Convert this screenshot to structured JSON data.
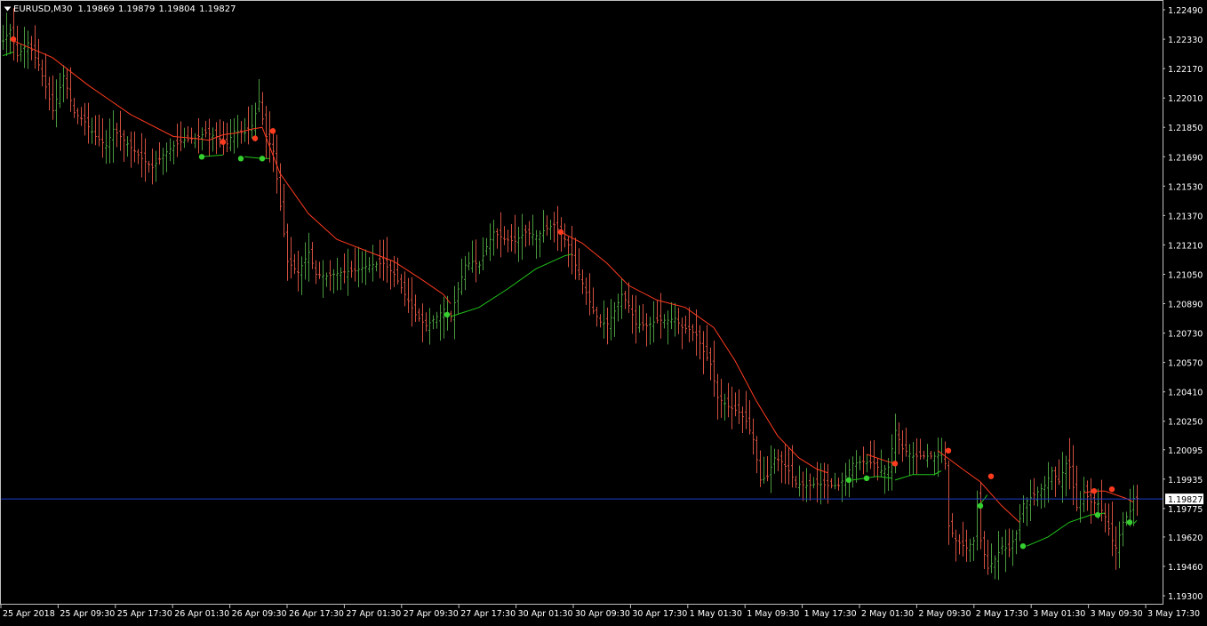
{
  "header": {
    "symbol_timeframe": "EURUSD,M30",
    "ohlc": "1.19869 1.19879 1.19804 1.19827"
  },
  "colors": {
    "background": "#000000",
    "frame": "#c0c0c0",
    "text": "#ffffff",
    "bull_bar": "#4a9a3e",
    "bear_bar": "#d2503f",
    "line_down": "#ff3b1f",
    "line_up": "#21c41a",
    "dot_down": "#ff3b1f",
    "dot_up": "#35d02f",
    "price_line": "#1e3cc8",
    "price_label_bg": "#ffffff",
    "price_label_text": "#000000"
  },
  "chart_data": {
    "type": "ohlc",
    "symbol": "EURUSD",
    "timeframe": "M30",
    "current_price": 1.19827,
    "current_price_label": "1.19827",
    "ylim": [
      1.193,
      1.2249
    ],
    "y_ticks": [
      "1.22490",
      "1.22330",
      "1.22170",
      "1.22010",
      "1.21850",
      "1.21690",
      "1.21530",
      "1.21370",
      "1.21210",
      "1.21050",
      "1.20890",
      "1.20730",
      "1.20570",
      "1.20410",
      "1.20250",
      "1.20095",
      "1.19935",
      "1.19775",
      "1.19620",
      "1.19460",
      "1.19300"
    ],
    "x_ticks": [
      "25 Apr 2018",
      "25 Apr 09:30",
      "25 Apr 17:30",
      "26 Apr 01:30",
      "26 Apr 09:30",
      "26 Apr 17:30",
      "27 Apr 01:30",
      "27 Apr 09:30",
      "27 Apr 17:30",
      "30 Apr 01:30",
      "30 Apr 09:30",
      "30 Apr 17:30",
      "1 May 01:30",
      "1 May 09:30",
      "1 May 17:30",
      "2 May 01:30",
      "2 May 09:30",
      "2 May 17:30",
      "3 May 01:30",
      "3 May 09:30",
      "3 May 17:30"
    ],
    "close_path": [
      [
        0,
        1.2232
      ],
      [
        2,
        1.2238
      ],
      [
        4,
        1.2224
      ],
      [
        7,
        1.2231
      ],
      [
        10,
        1.2219
      ],
      [
        12,
        1.2207
      ],
      [
        14,
        1.2194
      ],
      [
        17,
        1.2213
      ],
      [
        20,
        1.2193
      ],
      [
        23,
        1.2188
      ],
      [
        26,
        1.218
      ],
      [
        29,
        1.2175
      ],
      [
        31,
        1.2184
      ],
      [
        35,
        1.2176
      ],
      [
        39,
        1.2168
      ],
      [
        42,
        1.2163
      ],
      [
        45,
        1.217
      ],
      [
        48,
        1.2175
      ],
      [
        51,
        1.2178
      ],
      [
        54,
        1.2179
      ],
      [
        57,
        1.2182
      ],
      [
        60,
        1.218
      ],
      [
        63,
        1.2176
      ],
      [
        65,
        1.2183
      ],
      [
        68,
        1.2182
      ],
      [
        70,
        1.2186
      ],
      [
        72,
        1.2199
      ],
      [
        74,
        1.218
      ],
      [
        76,
        1.2172
      ],
      [
        80,
        1.2112
      ],
      [
        83,
        1.2106
      ],
      [
        86,
        1.2117
      ],
      [
        88,
        1.2105
      ],
      [
        91,
        1.2104
      ],
      [
        95,
        1.2106
      ],
      [
        99,
        1.2107
      ],
      [
        103,
        1.211
      ],
      [
        107,
        1.2111
      ],
      [
        110,
        1.2105
      ],
      [
        113,
        1.2094
      ],
      [
        116,
        1.2083
      ],
      [
        119,
        1.2077
      ],
      [
        122,
        1.2082
      ],
      [
        124,
        1.2086
      ],
      [
        126,
        1.2082
      ],
      [
        128,
        1.2097
      ],
      [
        130,
        1.211
      ],
      [
        132,
        1.2112
      ],
      [
        134,
        1.211
      ],
      [
        136,
        1.212
      ],
      [
        138,
        1.2128
      ],
      [
        141,
        1.2124
      ],
      [
        144,
        1.2123
      ],
      [
        147,
        1.2128
      ],
      [
        150,
        1.2126
      ],
      [
        153,
        1.213
      ],
      [
        155,
        1.2132
      ],
      [
        157,
        1.2127
      ],
      [
        159,
        1.2121
      ],
      [
        161,
        1.211
      ],
      [
        163,
        1.21
      ],
      [
        166,
        1.2085
      ],
      [
        168,
        1.2079
      ],
      [
        170,
        1.2078
      ],
      [
        172,
        1.2085
      ],
      [
        174,
        1.2094
      ],
      [
        176,
        1.2088
      ],
      [
        178,
        1.2078
      ],
      [
        181,
        1.2077
      ],
      [
        184,
        1.208
      ],
      [
        187,
        1.208
      ],
      [
        189,
        1.2081
      ],
      [
        191,
        1.2076
      ],
      [
        193,
        1.2075
      ],
      [
        195,
        1.2072
      ],
      [
        197,
        1.2063
      ],
      [
        199,
        1.2056
      ],
      [
        201,
        1.2038
      ],
      [
        204,
        1.2033
      ],
      [
        207,
        1.203
      ],
      [
        209,
        1.2025
      ],
      [
        211,
        1.2015
      ],
      [
        213,
        1.1993
      ],
      [
        215,
        1.1995
      ],
      [
        217,
        1.2005
      ],
      [
        219,
        1.2003
      ],
      [
        221,
        1.1998
      ],
      [
        223,
        1.1991
      ],
      [
        226,
        1.199
      ],
      [
        229,
        1.1991
      ],
      [
        232,
        1.199
      ],
      [
        235,
        1.199
      ],
      [
        237,
        1.1995
      ],
      [
        239,
        1.2002
      ],
      [
        242,
        1.2003
      ],
      [
        245,
        1.2002
      ],
      [
        247,
        1.1998
      ],
      [
        249,
        1.2
      ],
      [
        251,
        1.202
      ],
      [
        253,
        1.201
      ],
      [
        256,
        1.2006
      ],
      [
        259,
        1.2006
      ],
      [
        262,
        1.2006
      ],
      [
        264,
        1.2007
      ],
      [
        265,
        1.2002
      ],
      [
        266,
        1.1968
      ],
      [
        268,
        1.196
      ],
      [
        271,
        1.1956
      ],
      [
        273,
        1.196
      ],
      [
        274,
        1.1983
      ],
      [
        275,
        1.196
      ],
      [
        277,
        1.1945
      ],
      [
        279,
        1.195
      ],
      [
        281,
        1.1957
      ],
      [
        283,
        1.1955
      ],
      [
        285,
        1.1964
      ],
      [
        287,
        1.198
      ],
      [
        290,
        1.1985
      ],
      [
        293,
        1.199
      ],
      [
        295,
        1.1998
      ],
      [
        297,
        1.1992
      ],
      [
        299,
        1.2002
      ],
      [
        300,
        1.2
      ],
      [
        302,
        1.1978
      ],
      [
        304,
        1.1987
      ],
      [
        306,
        1.1981
      ],
      [
        308,
        1.198
      ],
      [
        310,
        1.1973
      ],
      [
        312,
        1.196
      ],
      [
        313,
        1.1956
      ],
      [
        315,
        1.197
      ],
      [
        317,
        1.1976
      ],
      [
        318,
        1.1983
      ]
    ],
    "trend_line": {
      "down": [
        [
          [
            2,
            1.2233
          ],
          [
            14,
            1.2223
          ],
          [
            24,
            1.2208
          ],
          [
            36,
            1.2192
          ],
          [
            48,
            1.218
          ],
          [
            54,
            1.2179
          ],
          [
            58,
            1.2178
          ],
          [
            62,
            1.2181
          ],
          [
            66,
            1.2182
          ],
          [
            70,
            1.2184
          ],
          [
            73,
            1.2185
          ],
          [
            78,
            1.216
          ],
          [
            86,
            1.2138
          ],
          [
            94,
            1.2124
          ],
          [
            102,
            1.2118
          ],
          [
            110,
            1.2112
          ],
          [
            118,
            1.2102
          ],
          [
            124,
            1.2094
          ],
          [
            126,
            1.2089
          ]
        ],
        [
          [
            157,
            1.2128
          ],
          [
            163,
            1.2122
          ],
          [
            170,
            1.2111
          ],
          [
            176,
            1.2099
          ],
          [
            184,
            1.2091
          ],
          [
            192,
            1.2087
          ],
          [
            200,
            1.2076
          ],
          [
            206,
            1.2058
          ],
          [
            212,
            1.2036
          ],
          [
            218,
            1.2017
          ],
          [
            224,
            1.2005
          ],
          [
            229,
            1.1999
          ],
          [
            232,
            1.1997
          ]
        ],
        [
          [
            243,
            1.2007
          ],
          [
            246,
            1.2005
          ],
          [
            249,
            1.2003
          ],
          [
            251,
            1.2002
          ]
        ],
        [
          [
            263,
            1.2009
          ],
          [
            270,
            1.1999
          ],
          [
            275,
            1.1992
          ],
          [
            281,
            1.1979
          ],
          [
            286,
            1.197
          ]
        ],
        [
          [
            304,
            1.1986
          ],
          [
            307,
            1.1987
          ],
          [
            310,
            1.1987
          ],
          [
            313,
            1.1985
          ],
          [
            316,
            1.1983
          ],
          [
            318,
            1.1981
          ]
        ]
      ],
      "up": [
        [
          [
            0,
            1.2224
          ],
          [
            3,
            1.2226
          ]
        ],
        [
          [
            56,
            1.2169
          ],
          [
            62,
            1.217
          ]
        ],
        [
          [
            68,
            1.2169
          ],
          [
            73,
            1.2168
          ],
          [
            75,
            1.2168
          ]
        ],
        [
          [
            126,
            1.2082
          ],
          [
            134,
            1.2087
          ],
          [
            142,
            1.2097
          ],
          [
            150,
            1.2108
          ],
          [
            158,
            1.2115
          ],
          [
            160,
            1.2116
          ]
        ],
        [
          [
            239,
            1.1993
          ],
          [
            246,
            1.1995
          ],
          [
            250,
            1.1994
          ]
        ],
        [
          [
            251,
            1.1993
          ],
          [
            256,
            1.1996
          ],
          [
            262,
            1.1996
          ],
          [
            264,
            1.1998
          ]
        ],
        [
          [
            275,
            1.198
          ],
          [
            277,
            1.1985
          ]
        ],
        [
          [
            288,
            1.1957
          ],
          [
            294,
            1.1962
          ],
          [
            300,
            1.197
          ],
          [
            306,
            1.1974
          ],
          [
            310,
            1.1975
          ]
        ],
        [
          [
            318,
            1.1969
          ],
          [
            319,
            1.1971
          ]
        ]
      ]
    },
    "signal_dots": {
      "down": [
        [
          3,
          1.2233
        ],
        [
          62,
          1.2177
        ],
        [
          71,
          1.2179
        ],
        [
          76,
          1.2183
        ],
        [
          157,
          1.2128
        ],
        [
          251,
          1.2002
        ],
        [
          266,
          1.2009
        ],
        [
          278,
          1.1995
        ],
        [
          307,
          1.1987
        ],
        [
          312,
          1.1988
        ]
      ],
      "up": [
        [
          56,
          1.2169
        ],
        [
          67,
          1.2168
        ],
        [
          73,
          1.2168
        ],
        [
          125,
          1.2083
        ],
        [
          238,
          1.1993
        ],
        [
          243,
          1.1994
        ],
        [
          275,
          1.1979
        ],
        [
          287,
          1.1957
        ],
        [
          308,
          1.1974
        ],
        [
          317,
          1.197
        ]
      ]
    }
  }
}
